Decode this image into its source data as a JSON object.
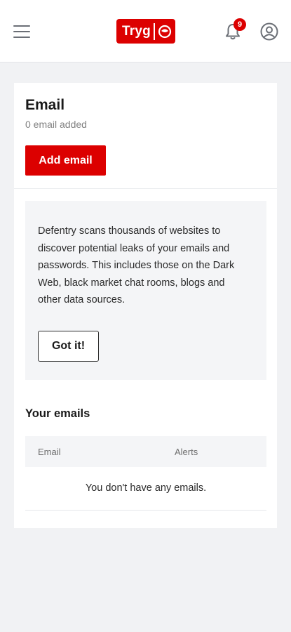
{
  "header": {
    "logo_text": "Tryg",
    "notification_count": "9",
    "icons": [
      "menu-icon",
      "bell-icon",
      "user-circle-icon",
      "tryg-logo-icon"
    ]
  },
  "email_section": {
    "title": "Email",
    "subtitle": "0 email added",
    "add_button_label": "Add email"
  },
  "info": {
    "text": "Defentry scans thousands of websites to discover potential leaks of your emails and passwords. This includes those on the Dark Web, black market chat rooms, blogs and other data sources.",
    "dismiss_button_label": "Got it!"
  },
  "emails": {
    "section_title": "Your emails",
    "columns": [
      "Email",
      "Alerts"
    ],
    "rows": [],
    "empty_message": "You don't have any emails."
  },
  "colors": {
    "brand": "#dc0000",
    "background": "#f1f2f4",
    "panel": "#f4f5f7"
  }
}
